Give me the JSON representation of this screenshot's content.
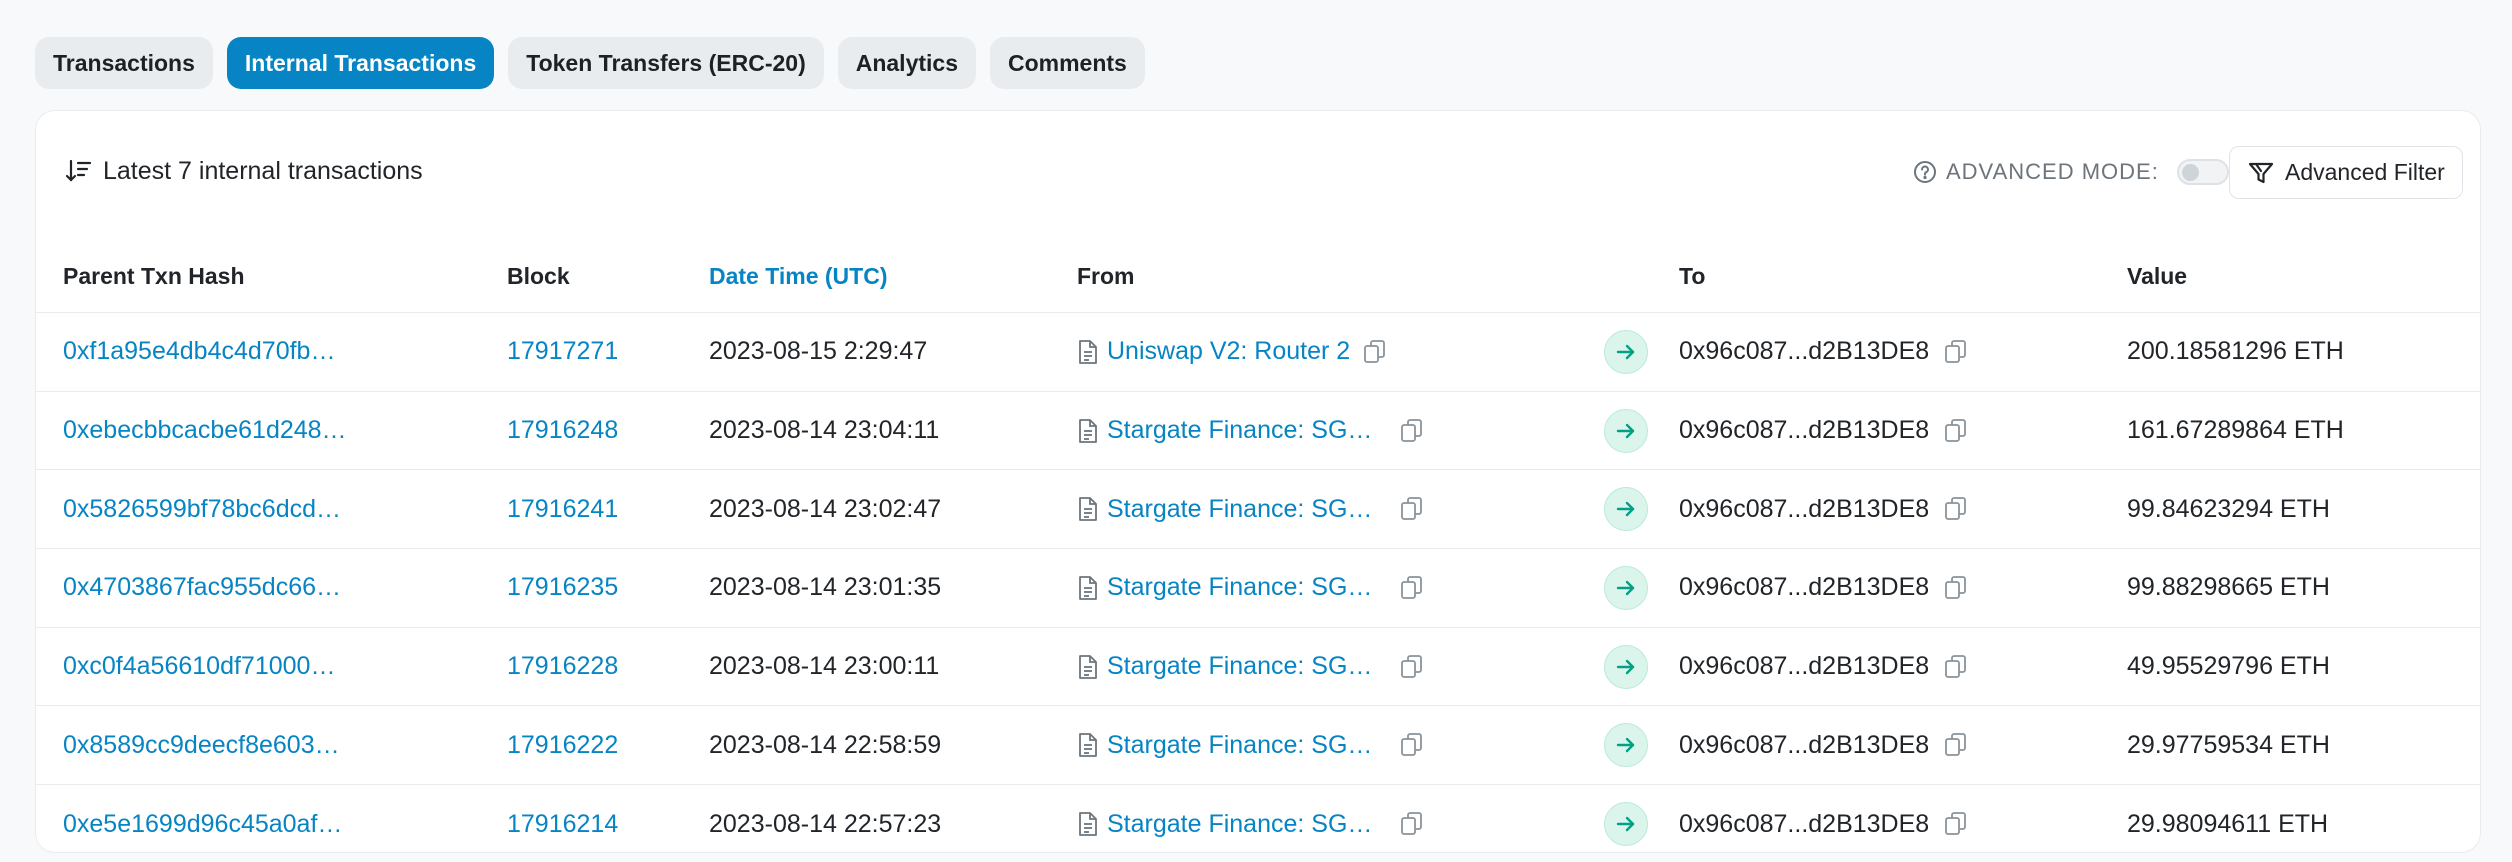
{
  "tabs": [
    {
      "label": "Transactions",
      "active": false
    },
    {
      "label": "Internal Transactions",
      "active": true
    },
    {
      "label": "Token Transfers (ERC-20)",
      "active": false
    },
    {
      "label": "Analytics",
      "active": false
    },
    {
      "label": "Comments",
      "active": false
    }
  ],
  "card": {
    "latest_label": "Latest 7 internal transactions",
    "advanced_mode_label": "ADVANCED MODE:",
    "advanced_mode_on": false,
    "advanced_filter_label": "Advanced Filter"
  },
  "table": {
    "columns": [
      "Parent Txn Hash",
      "Block",
      "Date Time (UTC)",
      "From",
      "To",
      "Value"
    ],
    "rows": [
      {
        "hash": "0xf1a95e4db4c4d70fb…",
        "block": "17917271",
        "datetime": "2023-08-15 2:29:47",
        "from": "Uniswap V2: Router 2",
        "to": "0x96c087...d2B13DE8",
        "value": "200.18581296 ETH"
      },
      {
        "hash": "0xebecbbcacbe61d248…",
        "block": "17916248",
        "datetime": "2023-08-14 23:04:11",
        "from": "Stargate Finance: SGE…",
        "to": "0x96c087...d2B13DE8",
        "value": "161.67289864 ETH"
      },
      {
        "hash": "0x5826599bf78bc6dcd…",
        "block": "17916241",
        "datetime": "2023-08-14 23:02:47",
        "from": "Stargate Finance: SGE…",
        "to": "0x96c087...d2B13DE8",
        "value": "99.84623294 ETH"
      },
      {
        "hash": "0x4703867fac955dc66…",
        "block": "17916235",
        "datetime": "2023-08-14 23:01:35",
        "from": "Stargate Finance: SGE…",
        "to": "0x96c087...d2B13DE8",
        "value": "99.88298665 ETH"
      },
      {
        "hash": "0xc0f4a56610df71000…",
        "block": "17916228",
        "datetime": "2023-08-14 23:00:11",
        "from": "Stargate Finance: SGE…",
        "to": "0x96c087...d2B13DE8",
        "value": "49.95529796 ETH"
      },
      {
        "hash": "0x8589cc9deecf8e603…",
        "block": "17916222",
        "datetime": "2023-08-14 22:58:59",
        "from": "Stargate Finance: SGE…",
        "to": "0x96c087...d2B13DE8",
        "value": "29.97759534 ETH"
      },
      {
        "hash": "0xe5e1699d96c45a0af…",
        "block": "17916214",
        "datetime": "2023-08-14 22:57:23",
        "from": "Stargate Finance: SGE…",
        "to": "0x96c087...d2B13DE8",
        "value": "29.98094611 ETH"
      }
    ]
  },
  "icons": {
    "sort": "sort-descending-icon",
    "help": "question-circle-icon",
    "filter": "filter-icon",
    "contract": "contract-document-icon",
    "copy": "copy-icon",
    "arrow": "arrow-right-icon"
  },
  "colors": {
    "accent": "#0784c3",
    "arrow_bg": "#dcf5ec",
    "arrow_fg": "#00a186"
  }
}
